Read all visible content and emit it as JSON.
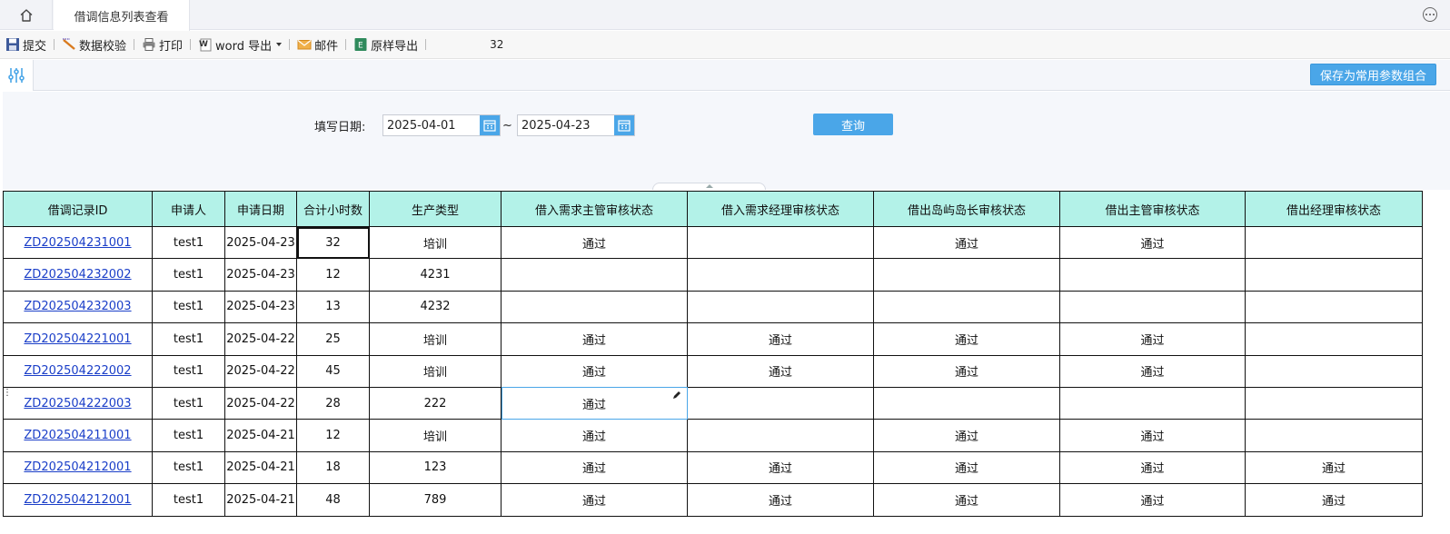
{
  "tabs": {
    "active_label": "借调信息列表查看"
  },
  "toolbar": {
    "submit": "提交",
    "validate": "数据校验",
    "print": "打印",
    "word_export": "word 导出",
    "mail": "邮件",
    "raw_export": "原样导出",
    "count": "32"
  },
  "params": {
    "save_combo": "保存为常用参数组合"
  },
  "query": {
    "date_label": "填写日期:",
    "date_from": "2025-04-01",
    "tilde": "~",
    "date_to": "2025-04-23",
    "query_btn": "查询"
  },
  "table": {
    "headers": [
      "借调记录ID",
      "申请人",
      "申请日期",
      "合计小时数",
      "生产类型",
      "借入需求主管审核状态",
      "借入需求经理审核状态",
      "借出岛屿岛长审核状态",
      "借出主管审核状态",
      "借出经理审核状态"
    ],
    "rows": [
      [
        "ZD202504231001",
        "test1",
        "2025-04-23",
        "32",
        "培训",
        "通过",
        "",
        "通过",
        "通过",
        ""
      ],
      [
        "ZD202504232002",
        "test1",
        "2025-04-23",
        "12",
        "4231",
        "",
        "",
        "",
        "",
        ""
      ],
      [
        "ZD202504232003",
        "test1",
        "2025-04-23",
        "13",
        "4232",
        "",
        "",
        "",
        "",
        ""
      ],
      [
        "ZD202504221001",
        "test1",
        "2025-04-22",
        "25",
        "培训",
        "通过",
        "通过",
        "通过",
        "通过",
        ""
      ],
      [
        "ZD202504222002",
        "test1",
        "2025-04-22",
        "45",
        "培训",
        "通过",
        "通过",
        "通过",
        "通过",
        ""
      ],
      [
        "ZD202504222003",
        "test1",
        "2025-04-22",
        "28",
        "222",
        "通过",
        "",
        "",
        "",
        ""
      ],
      [
        "ZD202504211001",
        "test1",
        "2025-04-21",
        "12",
        "培训",
        "通过",
        "",
        "通过",
        "通过",
        ""
      ],
      [
        "ZD202504212001",
        "test1",
        "2025-04-21",
        "18",
        "123",
        "通过",
        "通过",
        "通过",
        "通过",
        "通过"
      ],
      [
        "ZD202504212001",
        "test1",
        "2025-04-21",
        "48",
        "789",
        "通过",
        "通过",
        "通过",
        "通过",
        "通过"
      ]
    ]
  },
  "colors": {
    "accent": "#4aa6e8",
    "header_bg": "#b3f2e8",
    "link": "#1a3ec8"
  },
  "icons": [
    "home-icon",
    "more-icon",
    "save-icon",
    "validate-icon",
    "print-icon",
    "word-icon",
    "mail-icon",
    "excel-icon",
    "filter-settings-icon",
    "calendar-icon",
    "pencil-icon"
  ]
}
